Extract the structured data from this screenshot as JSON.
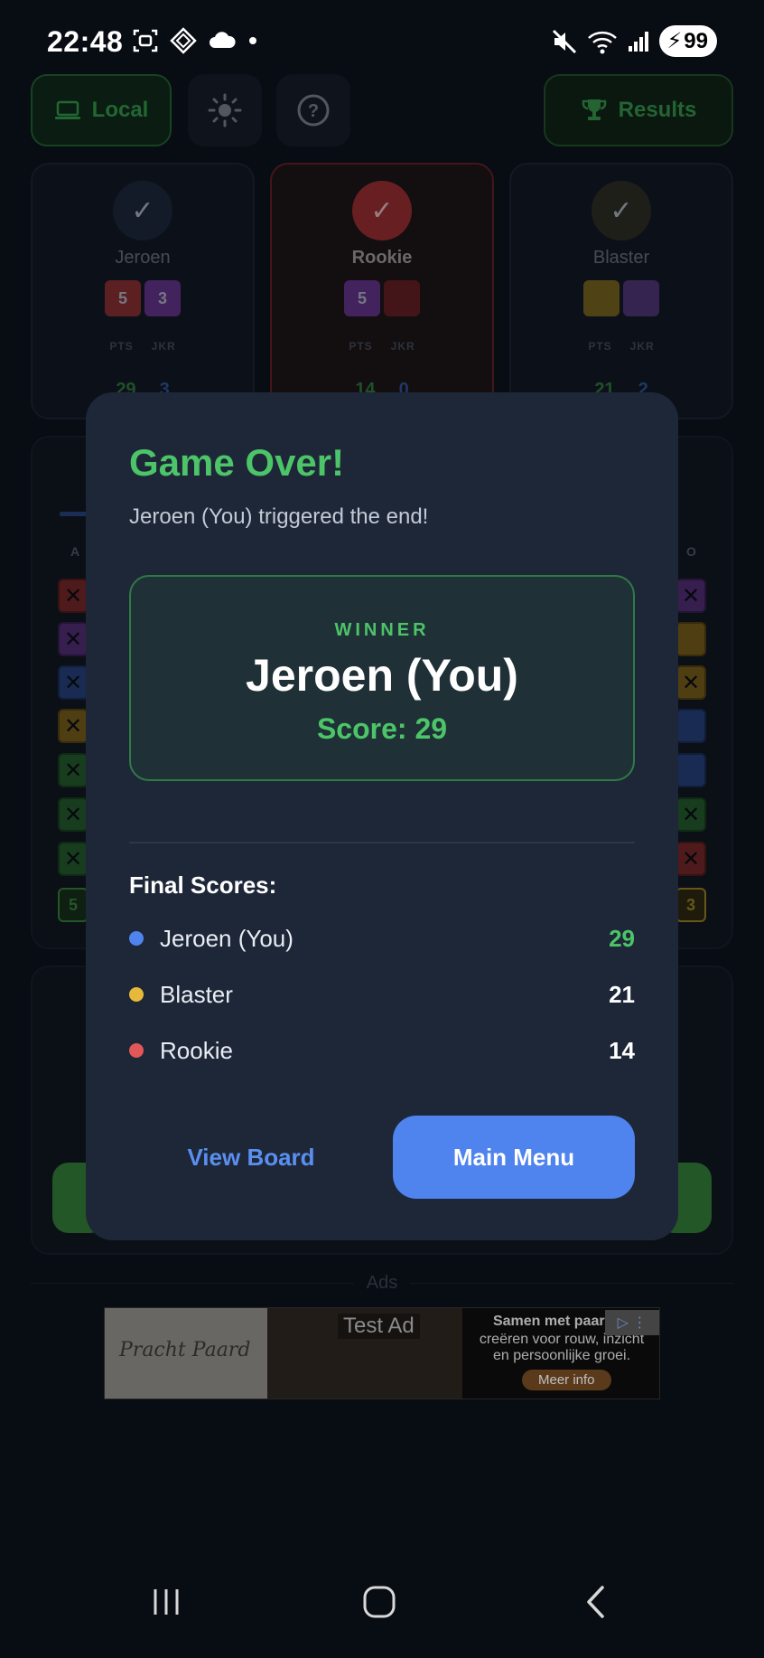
{
  "status_bar": {
    "time": "22:48",
    "battery": "99",
    "left_icons": [
      "screenshot-icon",
      "app-icon",
      "cloud-icon",
      "dot-icon"
    ],
    "right_icons": [
      "mute-icon",
      "wifi-icon",
      "signal-icon",
      "battery-icon"
    ]
  },
  "background": {
    "top_buttons": {
      "local_label": "Local",
      "results_label": "Results"
    },
    "players": [
      {
        "name": "Jeroen",
        "chip_a": "5",
        "chip_b": "3",
        "pts_label": "PTS",
        "jkr_label": "JKR",
        "pts": "29",
        "jkr": "3",
        "avatar_color": "#1a2336",
        "chip_a_color": "#7b2a2e",
        "chip_b_color": "#5a2f7c"
      },
      {
        "name": "Rookie",
        "chip_a": "5",
        "chip_b": "",
        "pts_label": "PTS",
        "jkr_label": "JKR",
        "pts": "14",
        "jkr": "0",
        "avatar_color": "#8a2a2e",
        "chip_a_color": "#5a2f7c",
        "chip_b_color": "#5a1c20"
      },
      {
        "name": "Blaster",
        "chip_a": "",
        "chip_b": "",
        "pts_label": "PTS",
        "jkr_label": "JKR",
        "pts": "21",
        "jkr": "2",
        "avatar_color": "#2a2a22",
        "chip_a_color": "#6a5a1c",
        "chip_b_color": "#47306a"
      }
    ],
    "board": {
      "col_left": "A",
      "col_right": "O",
      "left_bottom": "5",
      "right_bottom": "3"
    },
    "ads_label": "Ads",
    "ad": {
      "brand": "Pracht Paard",
      "test_label": "Test Ad",
      "line1": "Samen met paarden",
      "line2": "creëren voor rouw, inzicht",
      "line3": "en persoonlijke groei.",
      "cta": "Meer info"
    }
  },
  "modal": {
    "title": "Game Over!",
    "subtitle": "Jeroen (You) triggered the end!",
    "winner_label": "WINNER",
    "winner_name": "Jeroen (You)",
    "winner_score": "Score: 29",
    "final_scores_title": "Final Scores:",
    "scores": [
      {
        "name": "Jeroen (You)",
        "score": "29",
        "dot_color": "#4f83ee",
        "score_color": "#4cc468"
      },
      {
        "name": "Blaster",
        "score": "21",
        "dot_color": "#e6b93a",
        "score_color": "#ffffff"
      },
      {
        "name": "Rookie",
        "score": "14",
        "dot_color": "#e25757",
        "score_color": "#ffffff"
      }
    ],
    "view_board_label": "View Board",
    "main_menu_label": "Main Menu"
  },
  "colors": {
    "accent_green": "#4cc468",
    "accent_blue": "#4f83ee",
    "modal_bg": "#1e2738"
  }
}
